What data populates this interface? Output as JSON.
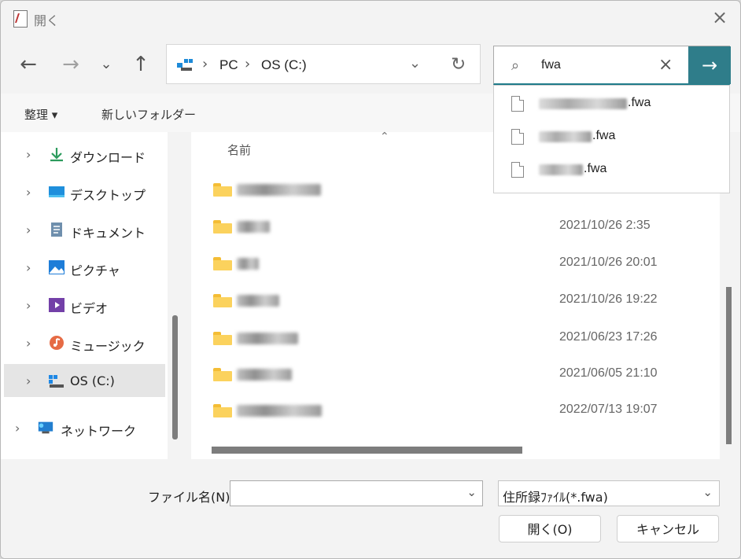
{
  "window": {
    "title": "開く"
  },
  "address": {
    "crumbs": [
      "PC",
      "OS (C:)"
    ]
  },
  "search": {
    "value": "fwa"
  },
  "toolbar": {
    "organize_label": "整理 ▾",
    "new_folder_label": "新しいフォルダー"
  },
  "sidebar": {
    "items": [
      {
        "label": "ダウンロード",
        "icon": "download-icon"
      },
      {
        "label": "デスクトップ",
        "icon": "desktop-icon"
      },
      {
        "label": "ドキュメント",
        "icon": "document-icon"
      },
      {
        "label": "ピクチャ",
        "icon": "picture-icon"
      },
      {
        "label": "ビデオ",
        "icon": "video-icon"
      },
      {
        "label": "ミュージック",
        "icon": "music-icon"
      },
      {
        "label": "OS (C:)",
        "icon": "drive-icon",
        "selected": true
      },
      {
        "label": "ネットワーク",
        "icon": "network-icon"
      }
    ]
  },
  "files": {
    "header_name": "名前",
    "rows": [
      {
        "date": ""
      },
      {
        "date": "2021/10/26 2:35"
      },
      {
        "date": "2021/10/26 20:01"
      },
      {
        "date": "2021/10/26 19:22"
      },
      {
        "date": "2021/06/23 17:26"
      },
      {
        "date": "2021/06/05 21:10"
      },
      {
        "date": "2022/07/13 19:07"
      }
    ]
  },
  "suggestions": [
    ".fwa",
    ".fwa",
    ".fwa"
  ],
  "footer": {
    "filename_label": "ファイル名(N):",
    "filename_value": "",
    "filter_value": "住所録ﾌｧｲﾙ(*.fwa)",
    "open_label": "開く(O)",
    "cancel_label": "キャンセル"
  }
}
